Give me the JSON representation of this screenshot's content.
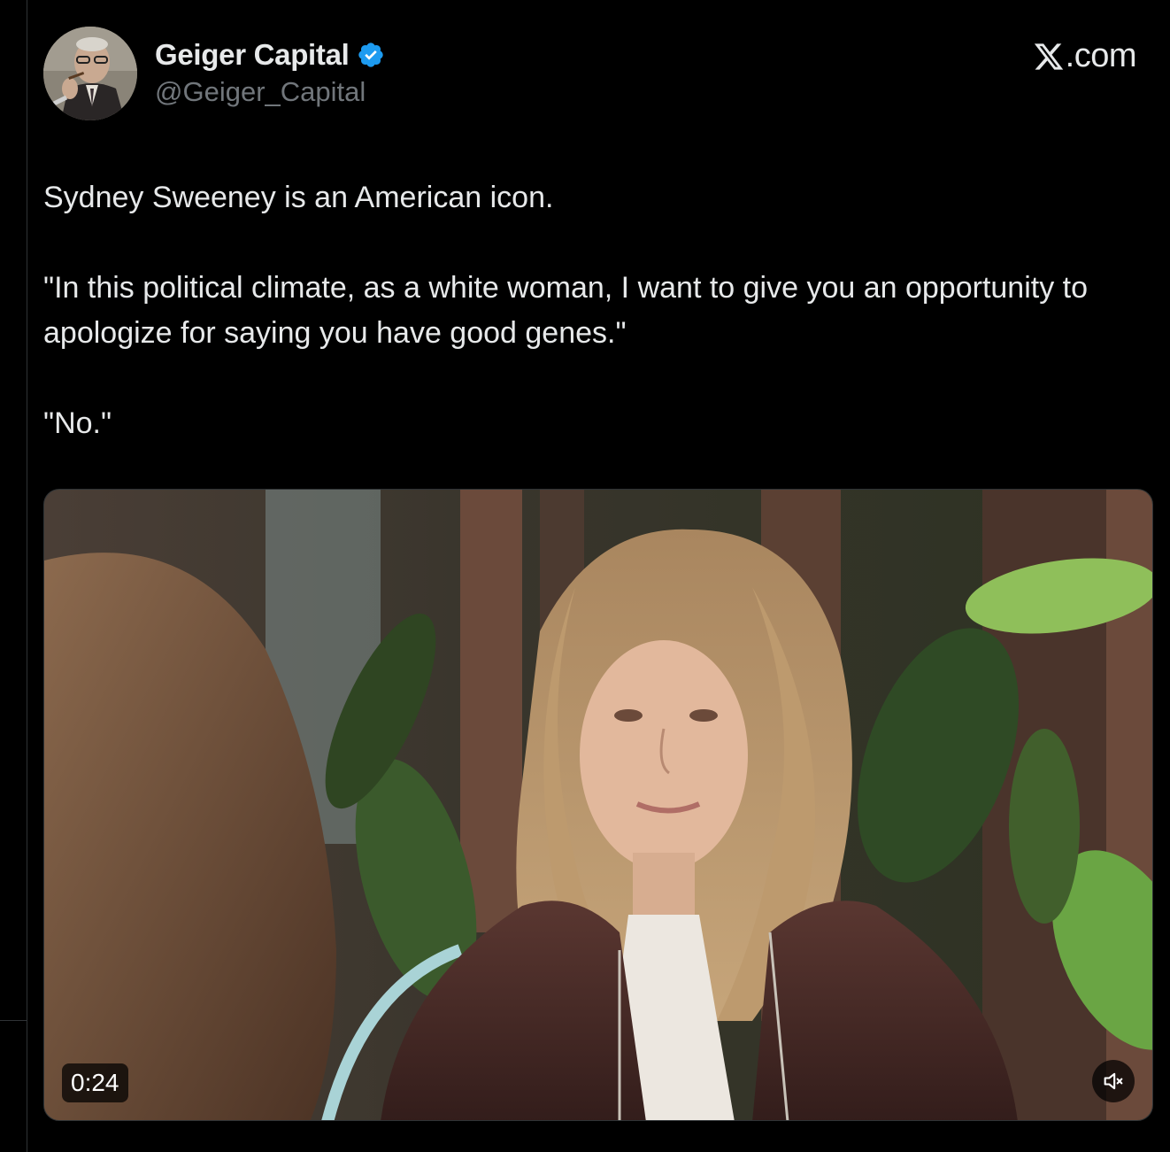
{
  "author": {
    "display_name": "Geiger Capital",
    "handle": "@Geiger_Capital",
    "verified_icon": "verified-badge-icon",
    "avatar": "profile-avatar-man-with-cigar"
  },
  "brand": {
    "label": ".com",
    "logo_icon": "x-logo-icon"
  },
  "tweet": {
    "paragraph_1": "Sydney Sweeney is an American icon.",
    "paragraph_2": "\"In this political climate, as a white woman, I want to give you an opportunity to apologize for saying you have good genes.\"",
    "paragraph_3": "\"No.\""
  },
  "video": {
    "duration": "0:24",
    "mute_icon": "speaker-muted-icon",
    "thumbnail": "video-still-woman-in-leather-jacket-among-plants"
  },
  "colors": {
    "background": "#000000",
    "text_primary": "#e7e9ea",
    "text_secondary": "#71767b",
    "verified_blue": "#1d9bf0",
    "border": "#2f3336"
  }
}
